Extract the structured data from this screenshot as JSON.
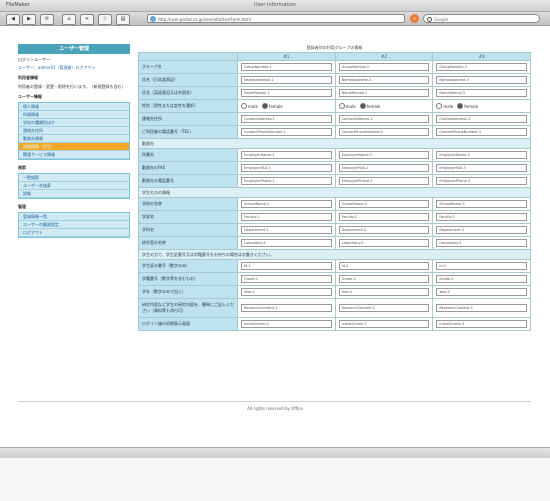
{
  "window": {
    "app_name": "FileMaker",
    "title": "User Information"
  },
  "toolbar": {
    "back": "◀",
    "forward": "▶",
    "reload": "⟳",
    "stop": "×",
    "address": "http://user.portal.co.jp/userinfo/UserForm.html",
    "search_placeholder": "Google"
  },
  "sidebar": {
    "header": "ユーザー管理",
    "user_label": "ログインユーザー",
    "user_info": "ユーザー：admin01（管理者）ログアウト",
    "sections": [
      {
        "title": "利用者情報",
        "text": "利用者の登録・変更・削除を行います。（新規登録も含む）"
      },
      {
        "title": "ユーザー情報",
        "items": [
          "個人情報",
          "所属情報",
          "学校の種類別ほか",
          "連絡先住所",
          "勤務先情報",
          "詳細情報（学生）",
          "関連サービス情報"
        ],
        "active_index": 5
      },
      {
        "title": "検索",
        "items": [
          "一覧検索",
          "ユーザー名検索",
          "詳細"
        ]
      },
      {
        "title": "管理",
        "items": [
          "登録情報一覧",
          "ユーザーの権限設定",
          "ログアウト"
        ]
      }
    ]
  },
  "form": {
    "title": "登録者別の利用グループの情報",
    "columns": [
      "#1",
      "#2",
      "#3"
    ],
    "rows": [
      {
        "type": "field",
        "label": "グループ名",
        "values": [
          "GroupNameJa.1",
          "GroupNameJa.2",
          "GroupNameJa.3"
        ]
      },
      {
        "type": "field",
        "label": "氏名（日本語表記）",
        "values": [
          "NameJapanese.1",
          "NameJapanese.2",
          "NameJapanese.3"
        ]
      },
      {
        "type": "field",
        "label": "氏名（英語表記又は外国名）",
        "values": [
          "NameRomaji.1",
          "NameRomaji.2",
          "NameRomaji.3"
        ]
      },
      {
        "type": "radio",
        "label": "性別（男性または女性を選択）",
        "options": [
          "male",
          "female"
        ],
        "selected": 1
      },
      {
        "type": "field",
        "label": "連絡先住所",
        "values": [
          "ContactAddress.1",
          "ContactAddress.2",
          "ContactAddress.3"
        ]
      },
      {
        "type": "field",
        "label": "ご利用者の電話番号（TEL）",
        "values": [
          "ContactPhoneNumber.1",
          "ContactPhoneNumber.2",
          "ContactPhoneNumber.3"
        ]
      },
      {
        "type": "section",
        "label": "勤務先"
      },
      {
        "type": "field",
        "label": "所属先",
        "values": [
          "EmployerName.1",
          "EmployerName.2",
          "EmployerName.3"
        ]
      },
      {
        "type": "field",
        "label": "勤務先のFAX",
        "values": [
          "EmployerFAX.1",
          "EmployerFAX.2",
          "EmployerFAX.3"
        ]
      },
      {
        "type": "field",
        "label": "勤務先の電話番号",
        "values": [
          "EmployerPhone.1",
          "EmployerPhone.2",
          "EmployerPhone.3"
        ]
      },
      {
        "type": "section",
        "label": "学生の方の情報"
      },
      {
        "type": "field",
        "label": "学校の名称",
        "values": [
          "SchoolName.1",
          "SchoolName.2",
          "SchoolName.3"
        ]
      },
      {
        "type": "field",
        "label": "学部名",
        "values": [
          "Faculty.1",
          "Faculty.2",
          "Faculty.3"
        ]
      },
      {
        "type": "field",
        "label": "学科名",
        "values": [
          "Department.1",
          "Department.2",
          "Department.3"
        ]
      },
      {
        "type": "field",
        "label": "研究室の名称",
        "values": [
          "Laboratory.1",
          "Laboratory.2",
          "Laboratory.3"
        ]
      },
      {
        "type": "section",
        "label": "学生の方で、学生証番号又は学籍番号をお持ちの場合はお書きください。"
      },
      {
        "type": "field",
        "label": "学生証の番号（数字のみ）",
        "values": [
          "Id.1",
          "Id.2",
          "Id.3"
        ]
      },
      {
        "type": "field",
        "label": "学籍番号（数字等を含むもの）",
        "values": [
          "Grade.1",
          "Grade.2",
          "Grade.3"
        ]
      },
      {
        "type": "field",
        "label": "学年（数字のみで記入）",
        "values": [
          "Year.1",
          "Year.2",
          "Year.3"
        ]
      },
      {
        "type": "tall",
        "label": "研究内容など学生の研究内容を、簡単にご記入ください（資料等も添付可）",
        "values": [
          "ResearchContent.1",
          "ResearchContent.2",
          "ResearchContent.3"
        ]
      },
      {
        "type": "field",
        "label": "ログイン後の初期表示画面",
        "values": [
          "InitialScreen.1",
          "InitialScreen.2",
          "InitialScreen.3"
        ]
      }
    ]
  },
  "footer": {
    "text": "All rights reserved by Office"
  },
  "colors": {
    "accent": "#4aa3b8",
    "label_bg": "#bfe3ee",
    "active": "#f5a623"
  }
}
